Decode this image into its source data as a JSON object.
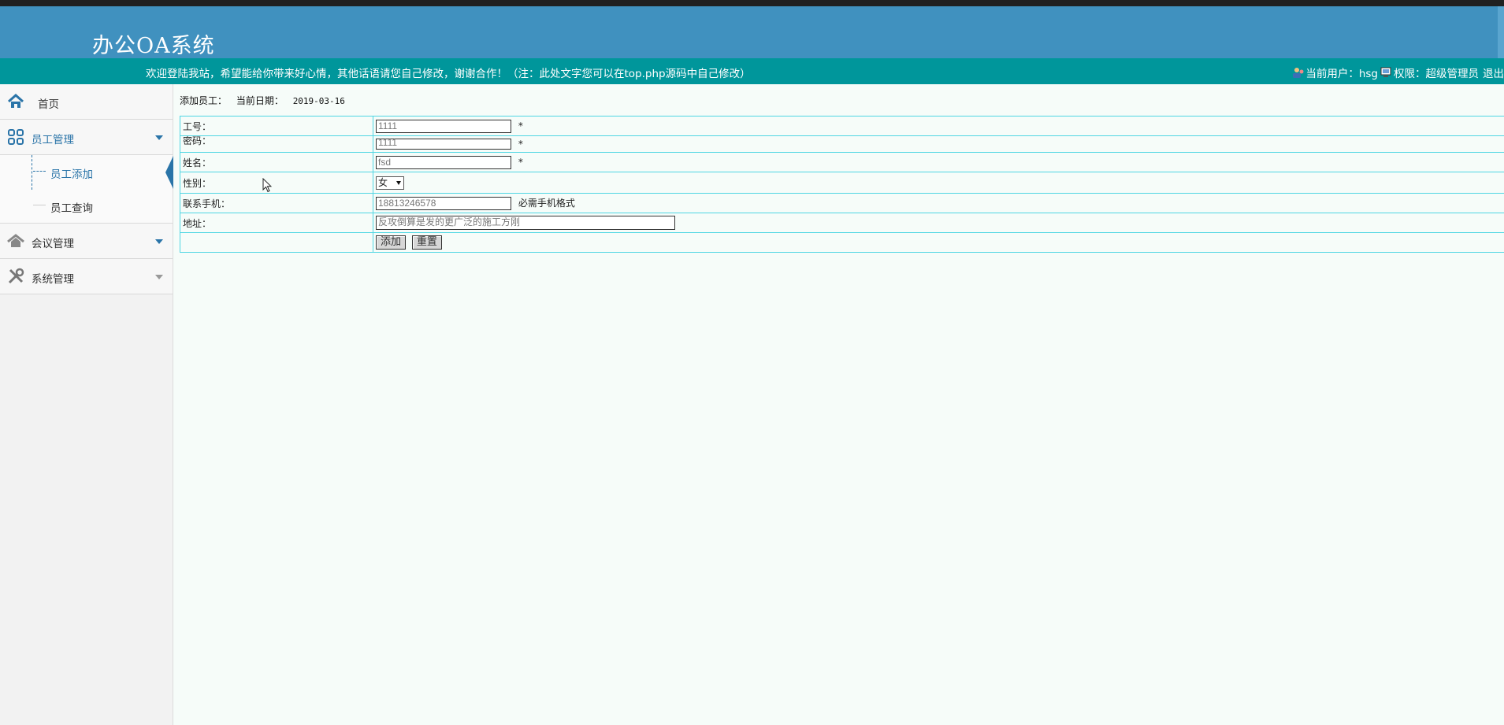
{
  "app": {
    "title": "办公OA系统"
  },
  "welcome": {
    "message": "欢迎登陆我站，希望能给你带来好心情，其他话语请您自己修改，谢谢合作！（注：此处文字您可以在top.php源码中自己修改）",
    "user_label": "当前用户：hsg",
    "role_label": "权限：超级管理员",
    "logout": "退出"
  },
  "sidebar": {
    "home": "首页",
    "employee": "员工管理",
    "employee_sub": [
      "员工添加",
      "员工查询"
    ],
    "meeting": "会议管理",
    "system": "系统管理"
  },
  "content": {
    "crumb_label": "添加员工：",
    "date_label": "当前日期：",
    "date_value": "2019-03-16",
    "form": {
      "job_no_label": "工号：",
      "job_no_value": "1111",
      "password_label": "密码：",
      "password_value": "1111",
      "name_label": "姓名：",
      "name_value": "fsd",
      "gender_label": "性别：",
      "gender_value": "女",
      "phone_label": "联系手机：",
      "phone_value": "18813246578",
      "phone_hint": "必需手机格式",
      "address_label": "地址：",
      "address_value": "反攻倒算是发的更广泛的施工方刚",
      "required_mark": "*",
      "add_button": "添加",
      "reset_button": "重置"
    }
  },
  "colors": {
    "header": "#4091bf",
    "welcome_bar": "#00969b",
    "accent": "#2a74a8",
    "table_border": "#4fd6e3"
  }
}
